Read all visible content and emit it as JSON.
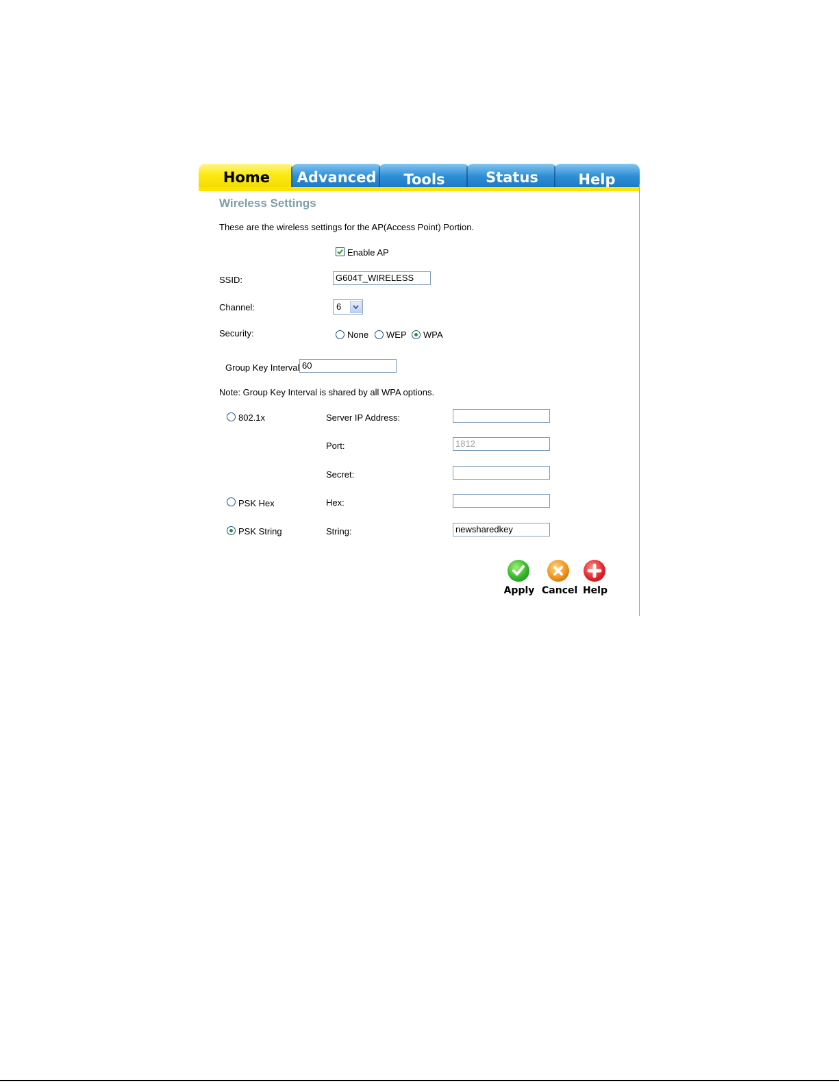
{
  "tabs": [
    {
      "label": "Home",
      "active": true
    },
    {
      "label": "Advanced",
      "active": false
    },
    {
      "label": "Tools",
      "active": false
    },
    {
      "label": "Status",
      "active": false
    },
    {
      "label": "Help",
      "active": false
    }
  ],
  "page": {
    "title": "Wireless Settings",
    "description": "These are the wireless settings for the AP(Access Point) Portion."
  },
  "form": {
    "enable_ap": {
      "label": "Enable AP",
      "checked": true
    },
    "ssid": {
      "label": "SSID:",
      "value": "G604T_WIRELESS"
    },
    "channel": {
      "label": "Channel:",
      "value": "6"
    },
    "security": {
      "label": "Security:",
      "options": [
        "None",
        "WEP",
        "WPA"
      ],
      "selected": "WPA"
    },
    "group_key_interval": {
      "label": "Group Key Interval:",
      "value": "60"
    },
    "note": "Note: Group Key Interval is shared by all WPA options.",
    "wpa_modes": {
      "dot1x": {
        "label": "802.1x",
        "selected": false
      },
      "psk_hex": {
        "label": "PSK Hex",
        "selected": false
      },
      "psk_string": {
        "label": "PSK String",
        "selected": true
      }
    },
    "server_ip": {
      "label": "Server IP Address:",
      "value": ""
    },
    "port": {
      "label": "Port:",
      "value": "1812"
    },
    "secret": {
      "label": "Secret:",
      "value": ""
    },
    "hex": {
      "label": "Hex:",
      "value": ""
    },
    "string": {
      "label": "String:",
      "value": "newsharedkey"
    }
  },
  "actions": {
    "apply": "Apply",
    "cancel": "Cancel",
    "help": "Help"
  },
  "colors": {
    "title": "#7e9daa",
    "active_tab": "#fbea10",
    "tab": "#1f80c8"
  }
}
